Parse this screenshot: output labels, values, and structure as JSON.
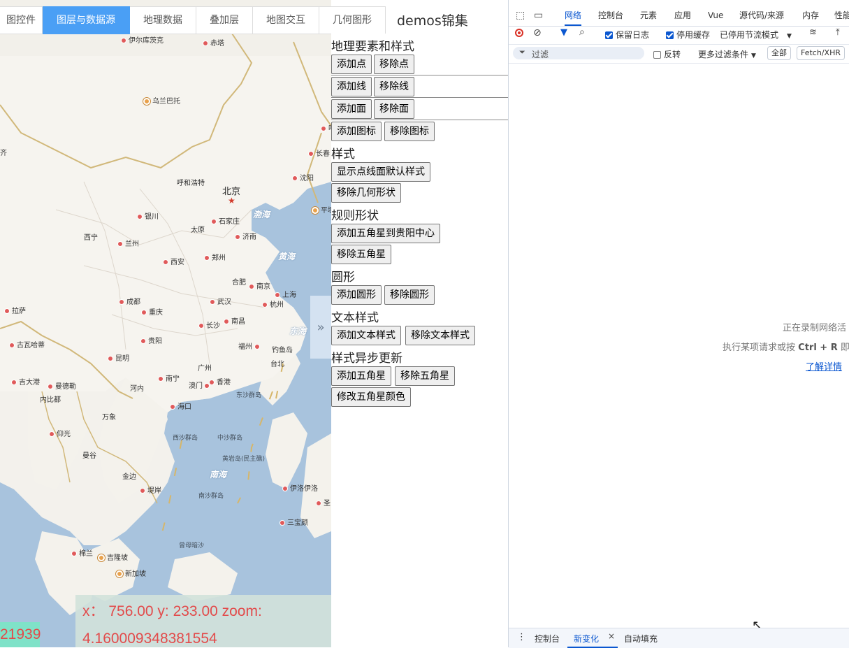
{
  "tabs": [
    {
      "label": "图控件",
      "active": false
    },
    {
      "label": "图层与数据源",
      "active": true
    },
    {
      "label": "地理数据",
      "active": false
    },
    {
      "label": "叠加层",
      "active": false
    },
    {
      "label": "地图交互",
      "active": false
    },
    {
      "label": "几何图形",
      "active": false
    }
  ],
  "demos_title": "demos锦集",
  "panel": {
    "sections": {
      "geo_features": "地理要素和样式",
      "style": "样式",
      "regular_shape": "规则形状",
      "circle": "圆形",
      "text_style": "文本样式",
      "async_style": "样式异步更新"
    },
    "buttons": {
      "add_point": "添加点",
      "remove_point": "移除点",
      "add_line": "添加线",
      "remove_line": "移除线",
      "add_polygon": "添加面",
      "remove_polygon": "移除面",
      "add_icon": "添加图标",
      "remove_icon": "移除图标",
      "show_default_style": "显示点线面默认样式",
      "remove_geometry": "移除几何形状",
      "add_star_guiyang": "添加五角星到贵阳中心",
      "remove_star": "移除五角星",
      "add_circle": "添加圆形",
      "remove_circle": "移除圆形",
      "add_text_style": "添加文本样式",
      "remove_text_style": "移除文本样式",
      "async_add_star": "添加五角星",
      "async_remove_star": "移除五角星",
      "change_star_color": "修改五角星颜色"
    }
  },
  "map": {
    "capital": "北京",
    "cities": [
      "伊尔库茨克",
      "赤塔",
      "乌兰巴托",
      "长春",
      "沈阳",
      "呼和浩特",
      "银川",
      "太原",
      "石家庄",
      "济南",
      "西宁",
      "兰州",
      "郑州",
      "西安",
      "合肥",
      "南京",
      "上海",
      "杭州",
      "成都",
      "武汉",
      "重庆",
      "长沙",
      "南昌",
      "拉萨",
      "贵阳",
      "福州",
      "台北",
      "昆明",
      "南宁",
      "广州",
      "澳门",
      "香港",
      "河内",
      "海口",
      "万象",
      "曼谷",
      "金边",
      "堤岸",
      "伊洛伊洛",
      "三宝颜",
      "棉兰",
      "吉隆坡",
      "新加坡",
      "吉大港",
      "曼德勒",
      "内比都",
      "仰光",
      "古瓦哈蒂",
      "齐",
      "平壤",
      "钓鱼岛",
      "哈",
      "圣"
    ],
    "seas": [
      "渤海",
      "黄海",
      "东海",
      "南海"
    ],
    "islands": [
      "东沙群岛",
      "西沙群岛",
      "中沙群岛",
      "黄岩岛(民主礁)",
      "南沙群岛",
      "曾母暗沙"
    ],
    "coords_line1": "x：  756.00 y: 233.00 zoom:",
    "coords_line2": "4.160009348381554",
    "scale_text": "21939",
    "collapse_icon": "double-chevron-right-icon"
  },
  "devtools": {
    "tabs": [
      "网络",
      "控制台",
      "元素",
      "应用",
      "Vue",
      "源代码/来源",
      "内存",
      "性能"
    ],
    "active_tab": "网络",
    "preserve_log": "保留日志",
    "disable_cache": "停用缓存",
    "throttle": "已停用节流模式",
    "filter_placeholder": "过滤",
    "invert": "反转",
    "more_filters": "更多过滤条件",
    "filter_all": "全部",
    "filter_fetch": "Fetch/XHR",
    "recording": "正在录制网络活",
    "perform_request": "执行某项请求或按",
    "shortcut": "Ctrl + R",
    "shortcut_suffix": "即",
    "learn_more": "了解详情",
    "bottom_tabs": [
      "控制台",
      "新变化",
      "自动填充"
    ],
    "bottom_active": "新变化"
  }
}
